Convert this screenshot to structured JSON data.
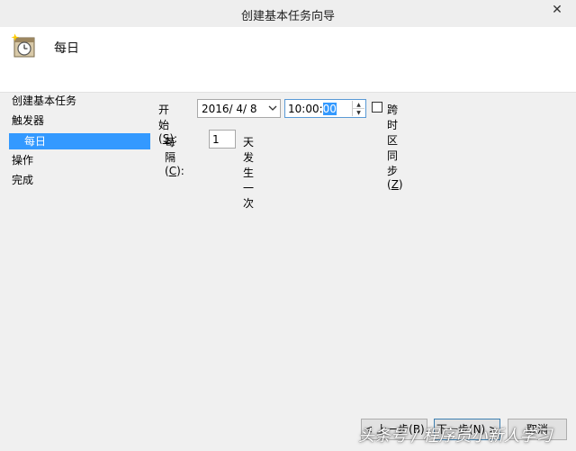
{
  "window": {
    "title": "创建基本任务向导",
    "close_glyph": "✕"
  },
  "header": {
    "title": "每日",
    "icon": "calendar-clock-icon"
  },
  "sidebar": {
    "items": [
      {
        "label": "创建基本任务"
      },
      {
        "label": "触发器"
      },
      {
        "label": "每日",
        "selected": true
      },
      {
        "label": "操作"
      },
      {
        "label": "完成"
      }
    ]
  },
  "form": {
    "start_label": "开始(",
    "start_key": "S",
    "start_tail": "):",
    "date_value": "2016/ 4/ 8",
    "time_value_prefix": "10:00:",
    "time_value_selected": "00",
    "sync_label": "跨时区同步(",
    "sync_key": "Z",
    "sync_tail": ")",
    "recur_label": "每隔(",
    "recur_key": "C",
    "recur_tail": "):",
    "recur_value": "1",
    "recur_suffix": "天发生一次"
  },
  "buttons": {
    "back": "< 上一步(B)",
    "next": "下一步(N) >",
    "cancel": "取消"
  },
  "watermark": "头条号 / 程序员小新人学习",
  "colors": {
    "accent": "#3399ff"
  }
}
